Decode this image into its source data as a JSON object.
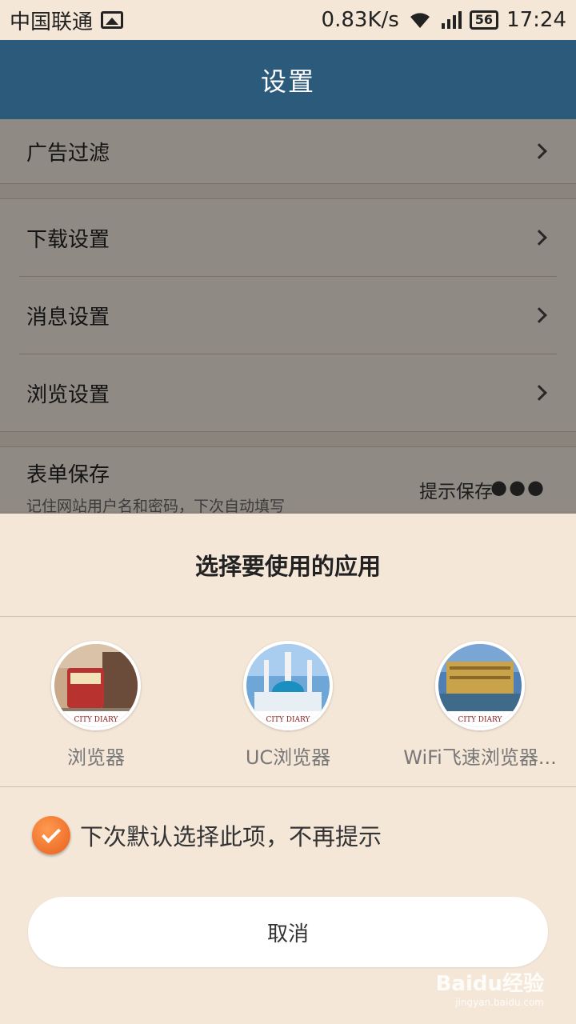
{
  "status_bar": {
    "carrier": "中国联通",
    "speed": "0.83K/s",
    "battery": "56",
    "time": "17:24"
  },
  "header": {
    "title": "设置"
  },
  "settings": {
    "ad_filter": "广告过滤",
    "download": "下载设置",
    "message": "消息设置",
    "browse": "浏览设置",
    "form_save": {
      "title": "表单保存",
      "description": "记住网站用户名和密码，下次自动填写",
      "value": "提示保存"
    }
  },
  "chooser": {
    "title": "选择要使用的应用",
    "apps": [
      {
        "label": "浏览器",
        "badge": "CITY DIARY"
      },
      {
        "label": "UC浏览器",
        "badge": "CITY DIARY"
      },
      {
        "label": "WiFi飞速浏览器...",
        "badge": "CITY DIARY"
      }
    ],
    "remember_label": "下次默认选择此项，不再提示",
    "remember_checked": true,
    "cancel_label": "取消"
  },
  "watermark": {
    "brand": "Baidu经验",
    "url": "jingyan.baidu.com"
  },
  "colors": {
    "header_bg": "#2c5a7b",
    "sheet_bg": "#f4e7d8",
    "checkbox": "#e8601c"
  }
}
